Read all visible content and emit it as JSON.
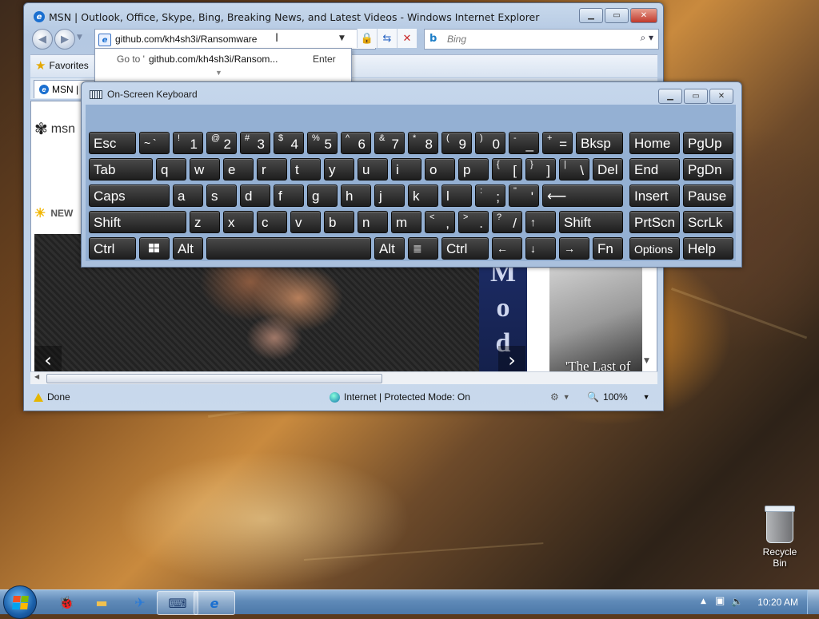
{
  "ie": {
    "title": "MSN | Outlook, Office, Skype, Bing, Breaking News, and Latest Videos - Windows Internet Explorer",
    "address": "github.com/kh4sh3i/Ransomware",
    "search_placeholder": "Bing",
    "favorites_label": "Favorites",
    "tab_label": "MSN |",
    "autocomplete": {
      "go_to": "Go to '",
      "url": "github.com/kh4sh3i/Ransom...",
      "enter": "Enter"
    },
    "page": {
      "logo": "msn",
      "news_label": "NEW",
      "sign_letters": [
        "M",
        "o",
        "d"
      ],
      "side_caption": "'The Last of"
    },
    "status": {
      "done": "Done",
      "zone": "Internet | Protected Mode: On",
      "zoom": "100%"
    }
  },
  "osk": {
    "title": "On-Screen Keyboard",
    "keys": {
      "esc": "Esc",
      "grave": "`",
      "tilde": "~",
      "k1": "1",
      "s1": "!",
      "k2": "2",
      "s2": "@",
      "k3": "3",
      "s3": "#",
      "k4": "4",
      "s4": "$",
      "k5": "5",
      "s5": "%",
      "k6": "6",
      "s6": "^",
      "k7": "7",
      "s7": "&",
      "k8": "8",
      "s8": "*",
      "k9": "9",
      "s9": "(",
      "k0": "0",
      "s0": ")",
      "minus": "-",
      "sminus": "_",
      "equal": "=",
      "sequal": "+",
      "bksp": "Bksp",
      "home": "Home",
      "pgup": "PgUp",
      "tab": "Tab",
      "q": "q",
      "w": "w",
      "e": "e",
      "r": "r",
      "t": "t",
      "y": "y",
      "u": "u",
      "i": "i",
      "o": "o",
      "p": "p",
      "lbr": "[",
      "slbr": "{",
      "rbr": "]",
      "srbr": "}",
      "bslash": "\\",
      "sbslash": "|",
      "del": "Del",
      "end": "End",
      "pgdn": "PgDn",
      "caps": "Caps",
      "a": "a",
      "s": "s",
      "d": "d",
      "f": "f",
      "g": "g",
      "h": "h",
      "j": "j",
      "k": "k",
      "l": "l",
      "semi": ";",
      "ssemi": ":",
      "quote": "'",
      "squote": "\"",
      "enter": "⟵",
      "insert": "Insert",
      "pause": "Pause",
      "shift": "Shift",
      "z": "z",
      "x": "x",
      "c": "c",
      "v": "v",
      "b": "b",
      "n": "n",
      "m": "m",
      "comma": ",",
      "scomma": "<",
      "period": ".",
      "speriod": ">",
      "slash": "/",
      "sslash": "?",
      "up": "↑",
      "prtscn": "PrtScn",
      "scrlk": "ScrLk",
      "ctrl": "Ctrl",
      "alt": "Alt",
      "menu": "≣",
      "left": "←",
      "down": "↓",
      "right": "→",
      "fn": "Fn",
      "options": "Options",
      "help": "Help"
    }
  },
  "desktop": {
    "recycle_bin": "Recycle Bin"
  },
  "taskbar": {
    "time": "10:20 AM"
  }
}
